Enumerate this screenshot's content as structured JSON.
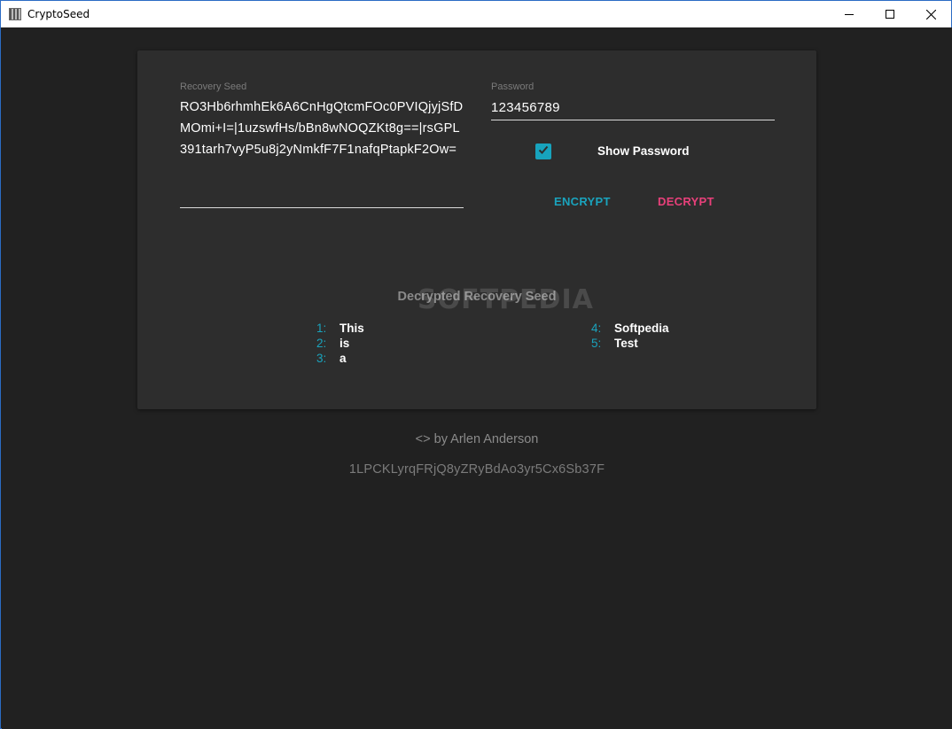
{
  "window": {
    "title": "CryptoSeed",
    "controls": [
      "minimize-icon",
      "maximize-icon",
      "close-icon"
    ]
  },
  "form": {
    "seed_label": "Recovery Seed",
    "seed_value": "RO3Hb6rhmhEk6A6CnHgQtcmFOc0PVIQjyjSfDMOmi+I=|1uzswfHs/bBn8wNOQZKt8g==|rsGPL391tarh7vyP5u8j2yNmkfF7F1nafqPtapkF2Ow=",
    "password_label": "Password",
    "password_value": "123456789",
    "show_password_label": "Show Password",
    "show_password_checked": true,
    "encrypt_label": "ENCRYPT",
    "decrypt_label": "DECRYPT"
  },
  "result": {
    "title": "Decrypted Recovery Seed",
    "watermark": "SOFTPEDIA",
    "words_left": [
      {
        "num": "1:",
        "word": "This"
      },
      {
        "num": "2:",
        "word": "is"
      },
      {
        "num": "3:",
        "word": "a"
      }
    ],
    "words_right": [
      {
        "num": "4:",
        "word": "Softpedia"
      },
      {
        "num": "5:",
        "word": "Test"
      }
    ]
  },
  "footer": {
    "author": "<> by Arlen Anderson",
    "address": "1LPCKLyrqFRjQ8yZRyBdAo3yr5Cx6Sb37F"
  },
  "colors": {
    "accent_teal": "#1aa3bd",
    "accent_pink": "#e8407a",
    "background": "#212121",
    "card": "#2d2d2d"
  }
}
